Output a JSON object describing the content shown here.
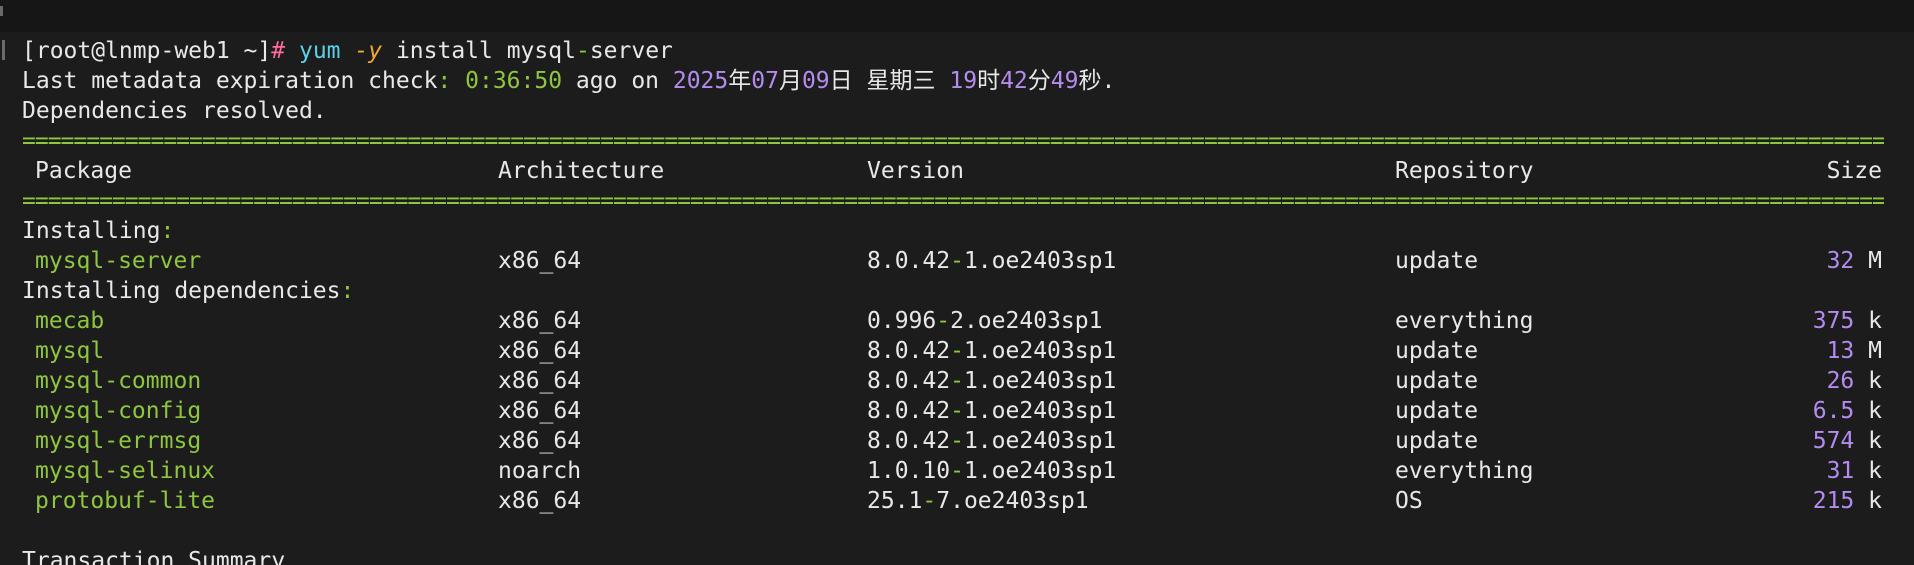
{
  "terminal": {
    "prompt": {
      "user_host": "[root@lnmp-web1 ~]",
      "hash": "#",
      "cmd_yum": "yum",
      "cmd_flag": "-y",
      "cmd_install": "install mysql",
      "cmd_dash": "-",
      "cmd_server": "server"
    },
    "metadata": {
      "prefix": "Last metadata expiration check",
      "colon": ":",
      "time": "0:36:50",
      "ago_on": " ago on ",
      "year": "2025",
      "year_char": "年",
      "month": "07",
      "month_char": "月",
      "day": "09",
      "day_char": "日",
      "weekday": " 星期三 ",
      "hour": "19",
      "hour_char": "时",
      "minute": "42",
      "minute_char": "分",
      "second": "49",
      "second_char": "秒."
    },
    "resolved": "Dependencies resolved.",
    "separator": "=============================================================================================================================================================================================",
    "headers": {
      "package": "Package",
      "arch": "Architecture",
      "version": "Version",
      "repo": "Repository",
      "size": "Size"
    },
    "installing_label": "Installing",
    "installing_dep_label": "Installing dependencies",
    "label_colon": ":",
    "installing": [
      {
        "name": "mysql-server",
        "arch": "x86_64",
        "ver_a": "8.0.42",
        "ver_b": "1.oe2403sp1",
        "repo": "update",
        "size_num": "32",
        "size_unit": "M"
      }
    ],
    "dependencies": [
      {
        "name": "mecab",
        "arch": "x86_64",
        "ver_a": "0.996",
        "ver_b": "2.oe2403sp1",
        "repo": "everything",
        "size_num": "375",
        "size_unit": "k"
      },
      {
        "name": "mysql",
        "arch": "x86_64",
        "ver_a": "8.0.42",
        "ver_b": "1.oe2403sp1",
        "repo": "update",
        "size_num": "13",
        "size_unit": "M"
      },
      {
        "name": "mysql-common",
        "arch": "x86_64",
        "ver_a": "8.0.42",
        "ver_b": "1.oe2403sp1",
        "repo": "update",
        "size_num": "26",
        "size_unit": "k"
      },
      {
        "name": "mysql-config",
        "arch": "x86_64",
        "ver_a": "8.0.42",
        "ver_b": "1.oe2403sp1",
        "repo": "update",
        "size_num": "6.5",
        "size_unit": "k"
      },
      {
        "name": "mysql-errmsg",
        "arch": "x86_64",
        "ver_a": "8.0.42",
        "ver_b": "1.oe2403sp1",
        "repo": "update",
        "size_num": "574",
        "size_unit": "k"
      },
      {
        "name": "mysql-selinux",
        "arch": "noarch",
        "ver_a": "1.0.10",
        "ver_b": "1.oe2403sp1",
        "repo": "everything",
        "size_num": "31",
        "size_unit": "k"
      },
      {
        "name": "protobuf-lite",
        "arch": "x86_64",
        "ver_a": "25.1",
        "ver_b": "7.oe2403sp1",
        "repo": "OS",
        "size_num": "215",
        "size_unit": "k"
      }
    ],
    "version_dash": "-",
    "summary": "Transaction Summary"
  },
  "colors": {
    "background": "#1c1c1c",
    "text": "#e8e8e8",
    "green": "#8ec63f",
    "purple": "#b48cf0",
    "prompt_hash": "#ff6b9a",
    "cmd_yum": "#5ad1e8",
    "cmd_flag": "#f0a830"
  }
}
